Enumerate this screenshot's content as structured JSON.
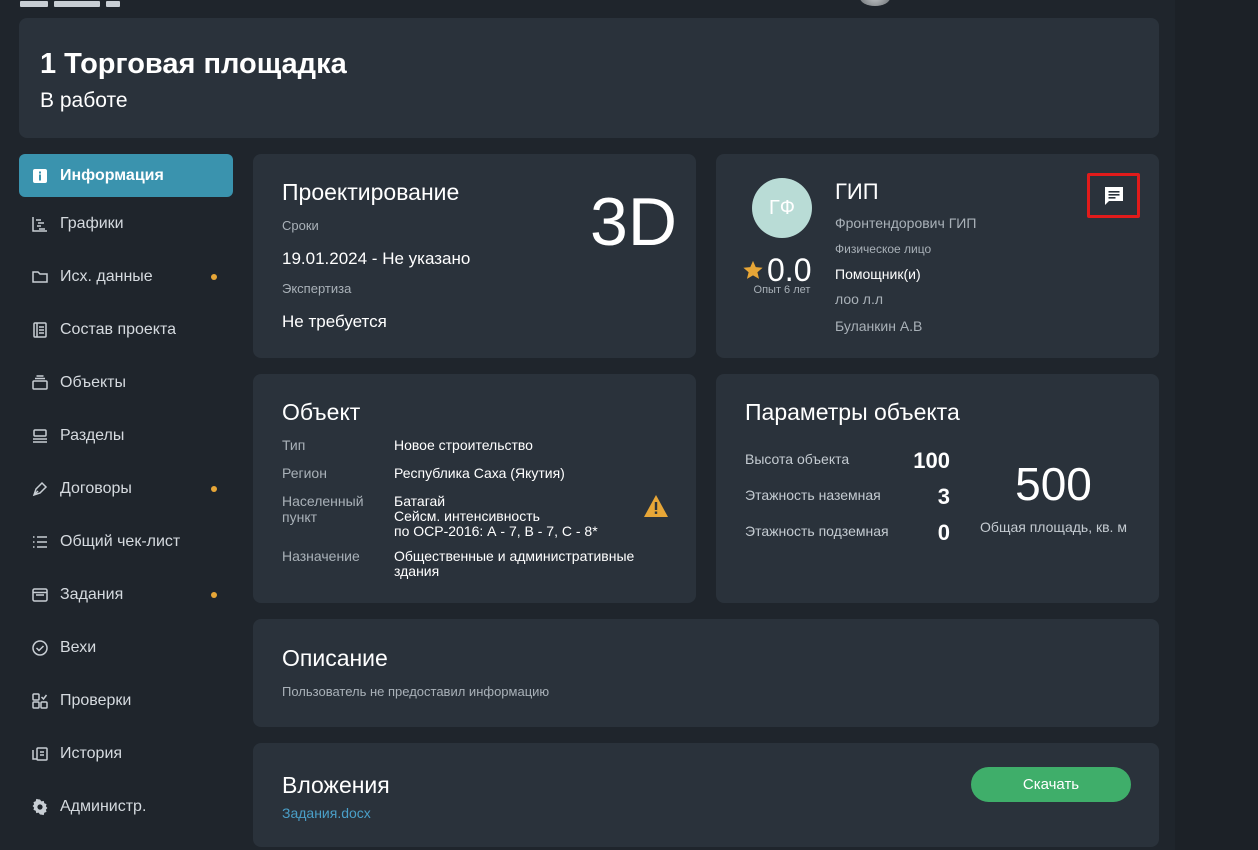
{
  "header": {
    "title": "1 Торговая площадка",
    "status": "В работе"
  },
  "sidebar": {
    "items": [
      {
        "label": "Информация",
        "icon": "info-icon",
        "active": true,
        "dot": false
      },
      {
        "label": "Графики",
        "icon": "gantt-icon",
        "active": false,
        "dot": false
      },
      {
        "label": "Исх. данные",
        "icon": "folder-icon",
        "active": false,
        "dot": true
      },
      {
        "label": "Состав проекта",
        "icon": "book-icon",
        "active": false,
        "dot": false
      },
      {
        "label": "Объекты",
        "icon": "layers-icon",
        "active": false,
        "dot": false
      },
      {
        "label": "Разделы",
        "icon": "sections-icon",
        "active": false,
        "dot": false
      },
      {
        "label": "Договоры",
        "icon": "pen-icon",
        "active": false,
        "dot": true
      },
      {
        "label": "Общий чек-лист",
        "icon": "checklist-icon",
        "active": false,
        "dot": false
      },
      {
        "label": "Задания",
        "icon": "tasks-icon",
        "active": false,
        "dot": true
      },
      {
        "label": "Вехи",
        "icon": "check-circle-icon",
        "active": false,
        "dot": false
      },
      {
        "label": "Проверки",
        "icon": "grid-check-icon",
        "active": false,
        "dot": false
      },
      {
        "label": "История",
        "icon": "history-icon",
        "active": false,
        "dot": false
      },
      {
        "label": "Администр.",
        "icon": "gear-icon",
        "active": false,
        "dot": false
      }
    ]
  },
  "design": {
    "title": "Проектирование",
    "badge": "3D",
    "deadline_label": "Сроки",
    "deadline_value": "19.01.2024 - Не указано",
    "expertise_label": "Экспертиза",
    "expertise_value": "Не требуется"
  },
  "gip": {
    "initials": "ГФ",
    "rating": "0.0",
    "experience": "Опыт 6 лет",
    "title": "ГИП",
    "name": "Фронтендорович ГИП",
    "person_type": "Физическое лицо",
    "assistants_label": "Помощник(и)",
    "assistants": [
      "лоо л.л",
      "Буланкин А.В"
    ]
  },
  "object": {
    "title": "Объект",
    "type_label": "Тип",
    "type_value": "Новое строительство",
    "region_label": "Регион",
    "region_value": "Республика Саха (Якутия)",
    "locality_label_1": "Населенный",
    "locality_label_2": "пункт",
    "locality_value_1": "Батагай",
    "locality_value_2": "Сейсм. интенсивность",
    "locality_value_3": "по ОСР-2016: А - 7, В - 7, С - 8*",
    "purpose_label": "Назначение",
    "purpose_value_1": "Общественные и административные",
    "purpose_value_2": "здания"
  },
  "params": {
    "title": "Параметры объекта",
    "height_label": "Высота объекта",
    "height_value": "100",
    "floors_above_label": "Этажность наземная",
    "floors_above_value": "3",
    "floors_below_label": "Этажность подземная",
    "floors_below_value": "0",
    "area_value": "500",
    "area_label": "Общая площадь, кв. м"
  },
  "description": {
    "title": "Описание",
    "text": "Пользователь не предоставил информацию"
  },
  "attachments": {
    "title": "Вложения",
    "file": "Задания.docx",
    "download_label": "Скачать"
  },
  "colors": {
    "background": "#1f252c",
    "card": "#2a323b",
    "accent": "#3a93ae",
    "dot": "#e7a637",
    "download": "#3fae6a",
    "link": "#4a9fc8",
    "highlight": "#e11b1b"
  }
}
